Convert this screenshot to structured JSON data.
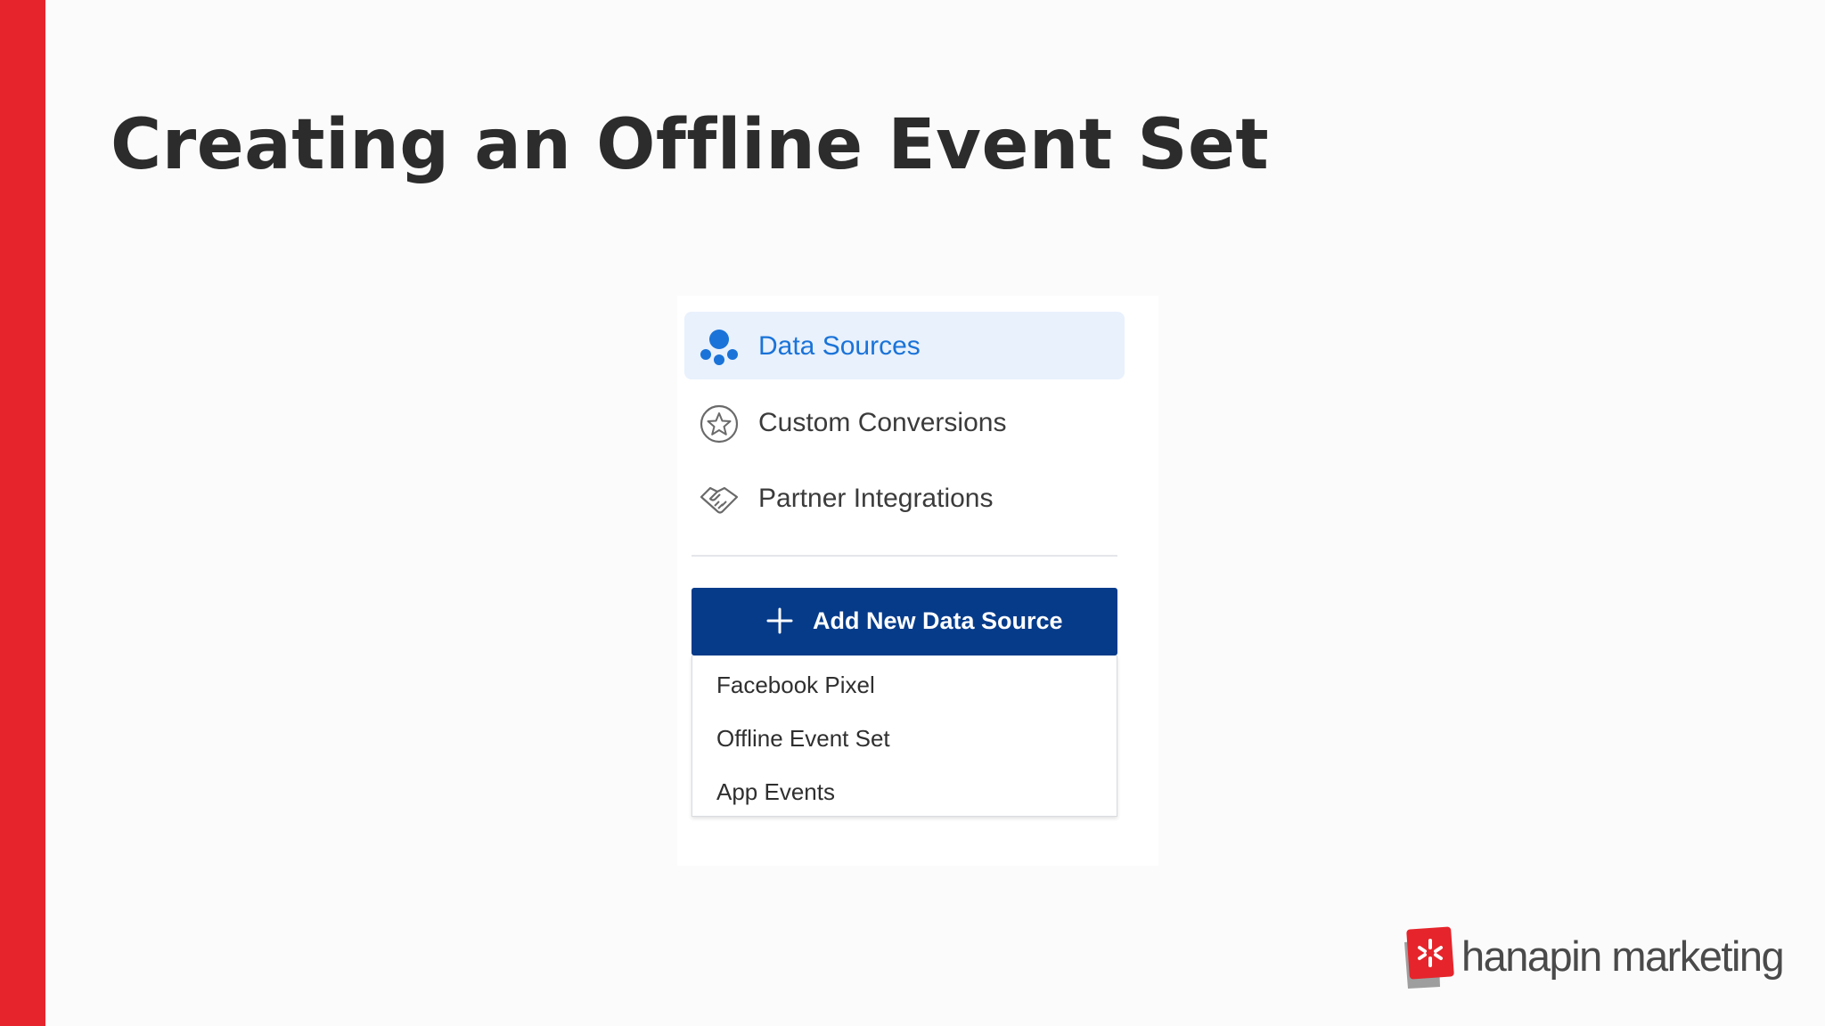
{
  "slide": {
    "title": "Creating an Offline Event Set"
  },
  "nav": {
    "items": [
      {
        "label": "Data Sources",
        "icon": "data-sources-icon",
        "active": true
      },
      {
        "label": "Custom Conversions",
        "icon": "star-circle-icon",
        "active": false
      },
      {
        "label": "Partner Integrations",
        "icon": "handshake-icon",
        "active": false
      }
    ]
  },
  "add_button": {
    "label": "Add New Data Source",
    "icon": "plus-icon"
  },
  "dropdown": {
    "items": [
      {
        "label": "Facebook Pixel"
      },
      {
        "label": "Offline Event Set"
      },
      {
        "label": "App Events"
      }
    ]
  },
  "logo": {
    "text": "hanapin marketing"
  },
  "colors": {
    "brand_red": "#e5252b",
    "active_blue": "#1a73d8",
    "active_bg": "#e8f1fc",
    "button_navy": "#063b8a",
    "title_text": "#2c2c2c"
  }
}
